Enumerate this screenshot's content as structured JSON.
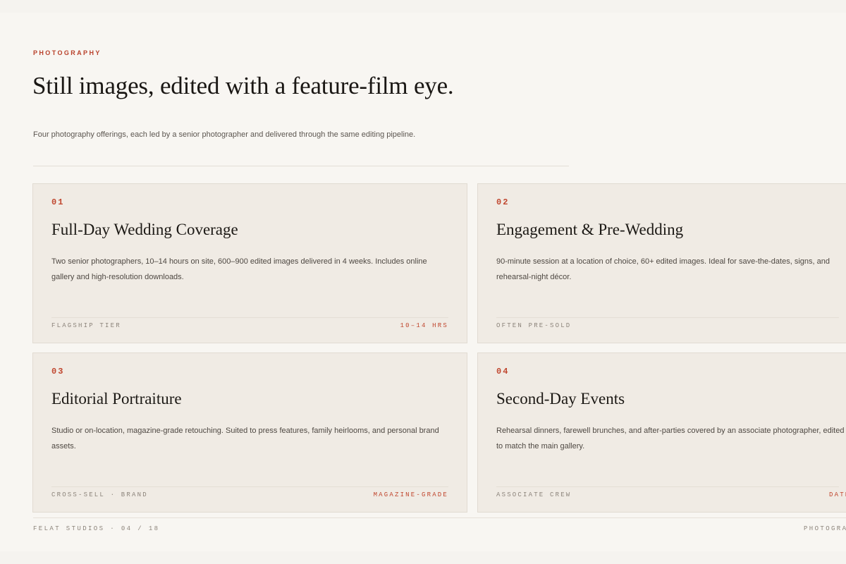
{
  "section": {
    "eyebrow": "PHOTOGRAPHY",
    "headline": "Still images, edited with a feature-film eye.",
    "intro": "Four photography offerings, each led by a senior photographer and delivered through the same editing pipeline."
  },
  "cards": [
    {
      "num": "01",
      "title": "Full-Day Wedding Coverage",
      "desc": "Two senior photographers, 10–14 hours on site, 600–900 edited images delivered in 4 weeks. Includes online gallery and high-resolution downloads.",
      "meta_left": "FLAGSHIP TIER",
      "meta_right": "10–14 HRS"
    },
    {
      "num": "02",
      "title": "Engagement & Pre-Wedding",
      "desc": "90-minute session at a location of choice, 60+ edited images. Ideal for save-the-dates, signs, and rehearsal-night décor.",
      "meta_left": "OFTEN PRE-SOLD",
      "meta_right": ""
    },
    {
      "num": "03",
      "title": "Editorial Portraiture",
      "desc": "Studio or on-location, magazine-grade retouching. Suited to press features, family heirlooms, and personal brand assets.",
      "meta_left": "CROSS-SELL · BRAND",
      "meta_right": "MAGAZINE-GRADE"
    },
    {
      "num": "04",
      "title": "Second-Day Events",
      "desc": "Rehearsal dinners, farewell brunches, and after-parties covered by an associate photographer, edited to match the main gallery.",
      "meta_left": "ASSOCIATE CREW",
      "meta_right": "DATE"
    }
  ],
  "footer": {
    "left": "FELAT STUDIOS · 04 / 18",
    "right": "PHOTOGRAPHY"
  }
}
